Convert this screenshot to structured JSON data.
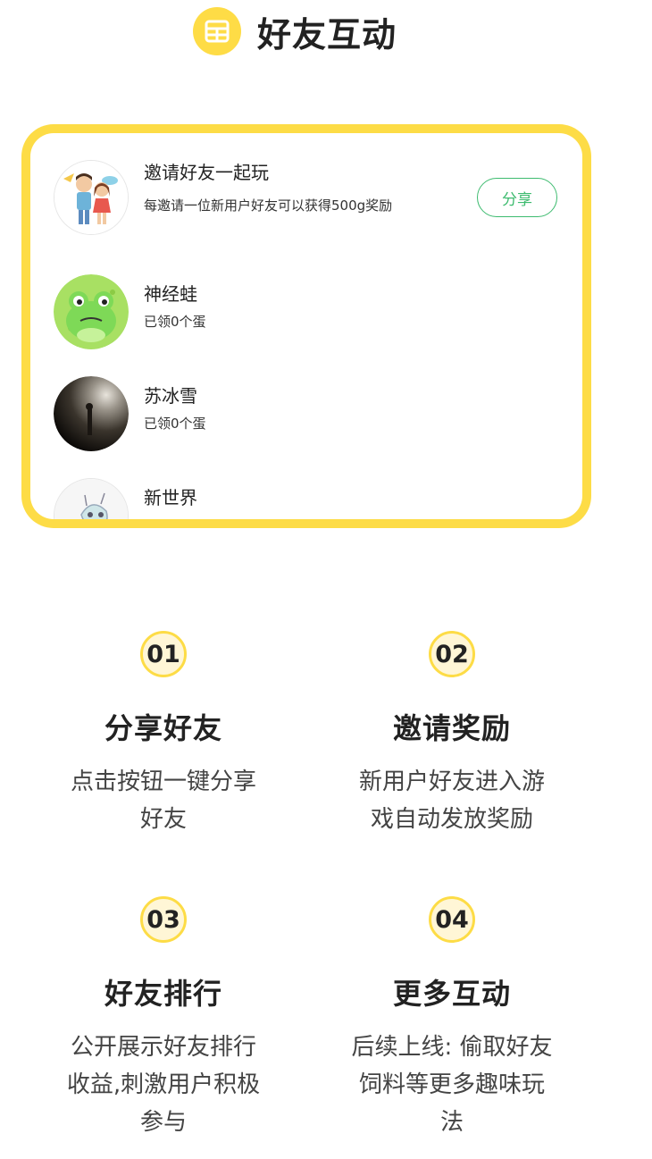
{
  "header": {
    "title": "好友互动",
    "icon": "grid-icon",
    "accent_color": "#FEDC46"
  },
  "friends": {
    "invite": {
      "title": "邀请好友一起玩",
      "desc": "每邀请一位新用户好友可以获得500g奖励",
      "share_label": "分享",
      "avatar_icon": "couple-cartoon-avatar"
    },
    "items": [
      {
        "name": "神经蛙",
        "status": "已领0个蛋",
        "avatar_icon": "frog-avatar"
      },
      {
        "name": "苏冰雪",
        "status": "已领0个蛋",
        "avatar_icon": "dark-photo-avatar"
      },
      {
        "name": "新世界",
        "avatar_icon": "sketch-avatar"
      }
    ]
  },
  "features": [
    {
      "num": "01",
      "title": "分享好友",
      "desc": "点击按钮一键分享好友"
    },
    {
      "num": "02",
      "title": "邀请奖励",
      "desc": "新用户好友进入游戏自动发放奖励"
    },
    {
      "num": "03",
      "title": "好友排行",
      "desc": "公开展示好友排行收益,刺激用户积极参与"
    },
    {
      "num": "04",
      "title": "更多互动",
      "desc": "后续上线: 偷取好友饲料等更多趣味玩法"
    }
  ],
  "colors": {
    "card_border": "#FDDC46",
    "share_green": "#3DBB6F"
  }
}
